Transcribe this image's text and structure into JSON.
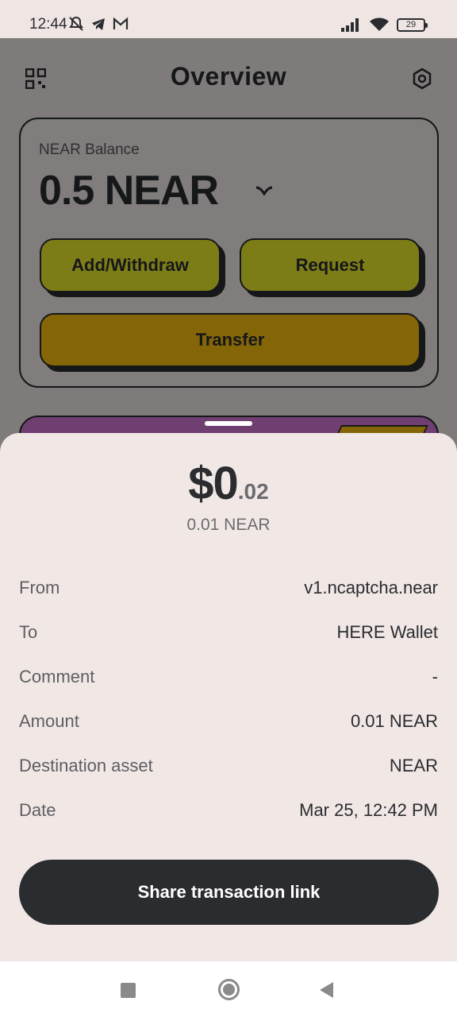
{
  "status_bar": {
    "time": "12:44",
    "battery": "29",
    "icons": [
      "notifications-off-icon",
      "telegram-icon",
      "gmail-icon",
      "signal-icon",
      "wifi-icon",
      "battery-icon"
    ]
  },
  "header": {
    "title": "Overview",
    "left_icon": "qr-code-icon",
    "right_icon": "settings-hexagon-icon"
  },
  "balance_card": {
    "label": "NEAR Balance",
    "value": "0.5 NEAR",
    "buttons": {
      "add_withdraw": "Add/Withdraw",
      "request": "Request",
      "transfer": "Transfer"
    }
  },
  "sheet": {
    "usd_main": "$0",
    "usd_cents": ".02",
    "near_amount": "0.01 NEAR",
    "details": [
      {
        "label": "From",
        "value": "v1.ncaptcha.near"
      },
      {
        "label": "To",
        "value": "HERE Wallet"
      },
      {
        "label": "Comment",
        "value": "-"
      },
      {
        "label": "Amount",
        "value": "0.01 NEAR"
      },
      {
        "label": "Destination asset",
        "value": "NEAR"
      },
      {
        "label": "Date",
        "value": "Mar 25, 12:42 PM"
      }
    ],
    "share_button": "Share transaction link"
  },
  "colors": {
    "accent_yellow": "#f0ef2f",
    "accent_orange": "#fdc410",
    "dark": "#2b2c30",
    "sheet_bg": "#f1e8e6"
  }
}
